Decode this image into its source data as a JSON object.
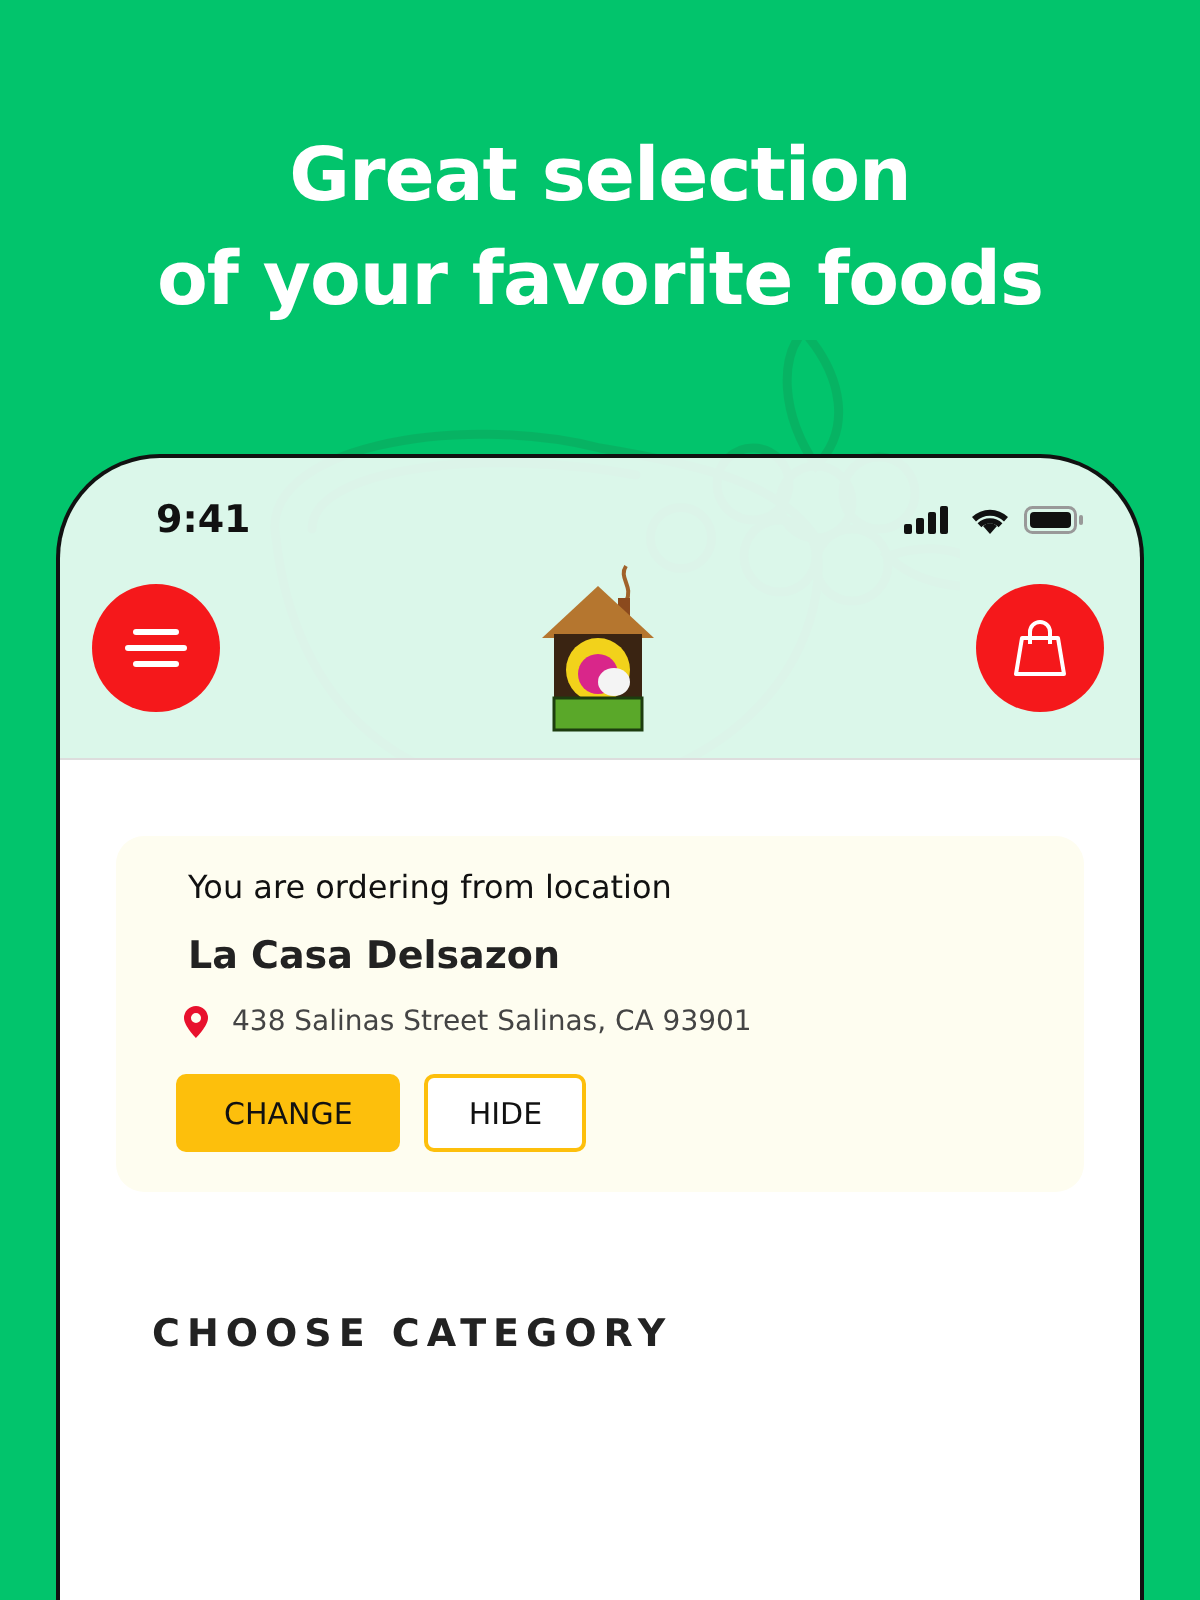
{
  "headline": [
    "Great selection",
    "of your favorite foods"
  ],
  "status_bar": {
    "time": "9:41"
  },
  "location_card": {
    "intro": "You are ordering from location",
    "name": "La Casa Delsazon",
    "address": "438 Salinas Street Salinas, CA 93901",
    "buttons": [
      {
        "label": "CHANGE",
        "kind": "primary"
      },
      {
        "label": "HIDE",
        "kind": "outline"
      }
    ]
  },
  "section_title": "CHOOSE CATEGORY"
}
